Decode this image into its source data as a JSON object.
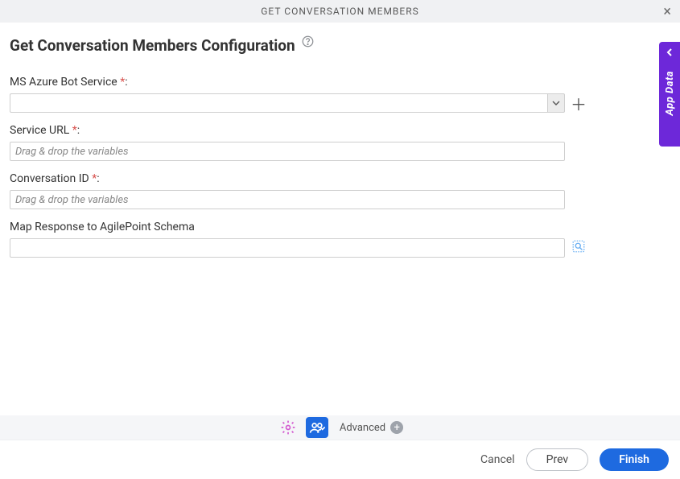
{
  "header": {
    "title": "GET CONVERSATION MEMBERS"
  },
  "page_title": "Get Conversation Members Configuration",
  "fields": {
    "azure": {
      "label": "MS Azure Bot Service",
      "required_marker": "*",
      "colon": ":"
    },
    "service_url": {
      "label": "Service URL",
      "required_marker": "*",
      "colon": ":",
      "placeholder": "Drag & drop the variables"
    },
    "conversation_id": {
      "label": "Conversation ID",
      "required_marker": "*",
      "colon": ":",
      "placeholder": "Drag & drop the variables"
    },
    "map_response": {
      "label": "Map Response to AgilePoint Schema"
    }
  },
  "toolbar": {
    "advanced_label": "Advanced"
  },
  "footer": {
    "cancel": "Cancel",
    "prev": "Prev",
    "finish": "Finish"
  },
  "side_tab": {
    "label": "App Data"
  }
}
